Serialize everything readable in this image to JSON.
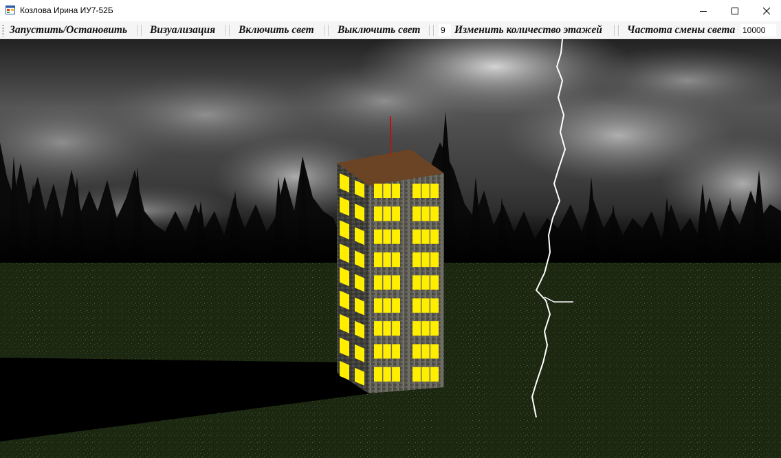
{
  "window": {
    "title": "Козлова Ирина ИУ7-52Б",
    "icon": "app-window-icon"
  },
  "toolbar": {
    "start_stop_label": "Запустить/Остановить",
    "visualization_label": "Визуализация",
    "light_on_label": "Включить свет",
    "light_off_label": "Выключить свет",
    "floors_value": "9",
    "change_floors_label": "Изменить количество этажей",
    "light_frequency_label": "Частота смены света",
    "frequency_value": "10000"
  },
  "scene": {
    "building_floors": 9,
    "window_light_color": "#ffee00",
    "roof_color": "#6a4425",
    "antenna_color": "#c01010",
    "ground_color": "#1c2a12",
    "sky_color": "#3a3a3a"
  }
}
